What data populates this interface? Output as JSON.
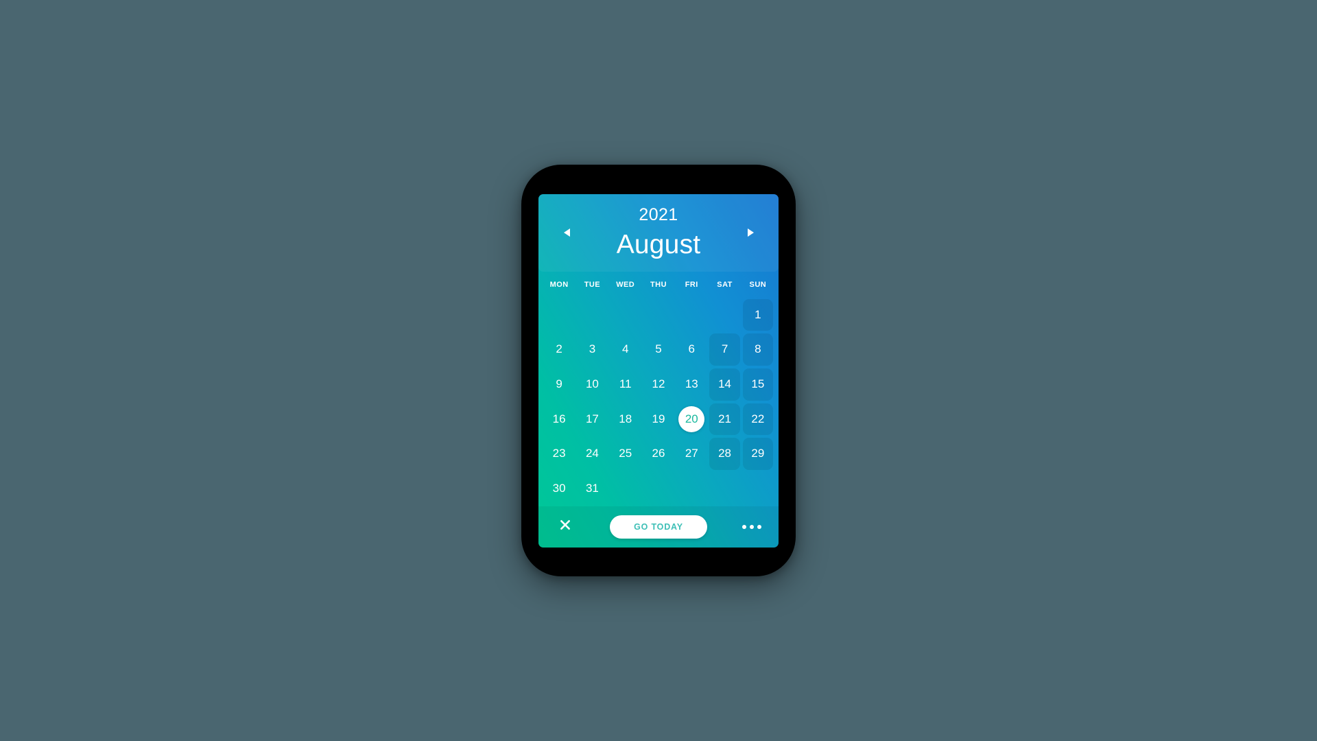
{
  "app": {
    "title": "August 2021 Calendar",
    "background_color": "#4a6670",
    "device_bezel_color": "#000000"
  },
  "card": {
    "gradient_from": "#00c896",
    "gradient_to": "#1877d2",
    "accent_teal": "#19b89e",
    "go_today_text_color": "#3dbfb6"
  },
  "header": {
    "year": "2021",
    "month": "August",
    "prev_icon": "triangle-left-icon",
    "next_icon": "triangle-right-icon"
  },
  "weekdays": [
    "MON",
    "TUE",
    "WED",
    "THU",
    "FRI",
    "SAT",
    "SUN"
  ],
  "calendar": {
    "selected_day": "20",
    "leading_blanks": 6,
    "days": [
      {
        "label": "1",
        "weekend": true,
        "selected": false
      },
      {
        "label": "2",
        "weekend": false,
        "selected": false
      },
      {
        "label": "3",
        "weekend": false,
        "selected": false
      },
      {
        "label": "4",
        "weekend": false,
        "selected": false
      },
      {
        "label": "5",
        "weekend": false,
        "selected": false
      },
      {
        "label": "6",
        "weekend": false,
        "selected": false
      },
      {
        "label": "7",
        "weekend": true,
        "selected": false
      },
      {
        "label": "8",
        "weekend": true,
        "selected": false
      },
      {
        "label": "9",
        "weekend": false,
        "selected": false
      },
      {
        "label": "10",
        "weekend": false,
        "selected": false
      },
      {
        "label": "11",
        "weekend": false,
        "selected": false
      },
      {
        "label": "12",
        "weekend": false,
        "selected": false
      },
      {
        "label": "13",
        "weekend": false,
        "selected": false
      },
      {
        "label": "14",
        "weekend": true,
        "selected": false
      },
      {
        "label": "15",
        "weekend": true,
        "selected": false
      },
      {
        "label": "16",
        "weekend": false,
        "selected": false
      },
      {
        "label": "17",
        "weekend": false,
        "selected": false
      },
      {
        "label": "18",
        "weekend": false,
        "selected": false
      },
      {
        "label": "19",
        "weekend": false,
        "selected": false
      },
      {
        "label": "20",
        "weekend": false,
        "selected": true
      },
      {
        "label": "21",
        "weekend": true,
        "selected": false
      },
      {
        "label": "22",
        "weekend": true,
        "selected": false
      },
      {
        "label": "23",
        "weekend": false,
        "selected": false
      },
      {
        "label": "24",
        "weekend": false,
        "selected": false
      },
      {
        "label": "25",
        "weekend": false,
        "selected": false
      },
      {
        "label": "26",
        "weekend": false,
        "selected": false
      },
      {
        "label": "27",
        "weekend": false,
        "selected": false
      },
      {
        "label": "28",
        "weekend": true,
        "selected": false
      },
      {
        "label": "29",
        "weekend": true,
        "selected": false
      },
      {
        "label": "30",
        "weekend": false,
        "selected": false
      },
      {
        "label": "31",
        "weekend": false,
        "selected": false
      }
    ]
  },
  "footer": {
    "close_icon": "close-icon",
    "go_today_label": "GO TODAY",
    "more_icon": "more-horizontal-icon"
  }
}
